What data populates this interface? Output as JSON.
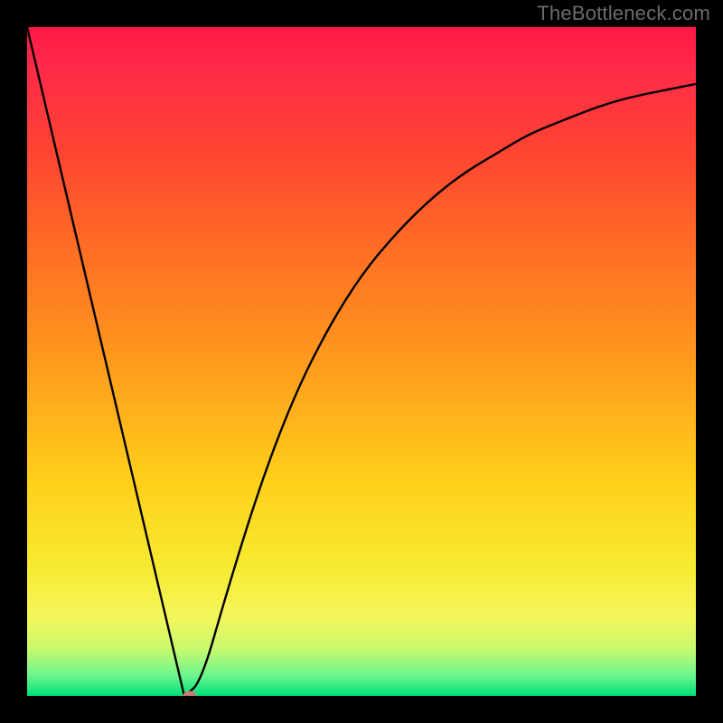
{
  "watermark": "TheBottleneck.com",
  "chart_data": {
    "type": "line",
    "title": "",
    "xlabel": "",
    "ylabel": "",
    "xlim": [
      0,
      100
    ],
    "ylim": [
      0,
      100
    ],
    "series": [
      {
        "name": "bottleneck-curve",
        "x": [
          0,
          23.5,
          26,
          30,
          35,
          40,
          45,
          50,
          55,
          60,
          65,
          70,
          75,
          80,
          85,
          90,
          95,
          100
        ],
        "values": [
          100,
          0,
          2,
          16,
          32,
          45,
          55,
          63,
          69,
          74,
          78,
          81,
          84,
          86,
          88,
          89.5,
          90.5,
          91.5
        ]
      }
    ],
    "marker": {
      "x": 24.3,
      "y": 0,
      "color": "#cb7a74"
    },
    "background_gradient": {
      "stops": [
        {
          "pos": 0,
          "color": "#ff1846"
        },
        {
          "pos": 18,
          "color": "#ff4333"
        },
        {
          "pos": 50,
          "color": "#ff9a1d"
        },
        {
          "pos": 80,
          "color": "#f7e92f"
        },
        {
          "pos": 93,
          "color": "#c8f96e"
        },
        {
          "pos": 100,
          "color": "#00e07a"
        }
      ]
    }
  }
}
